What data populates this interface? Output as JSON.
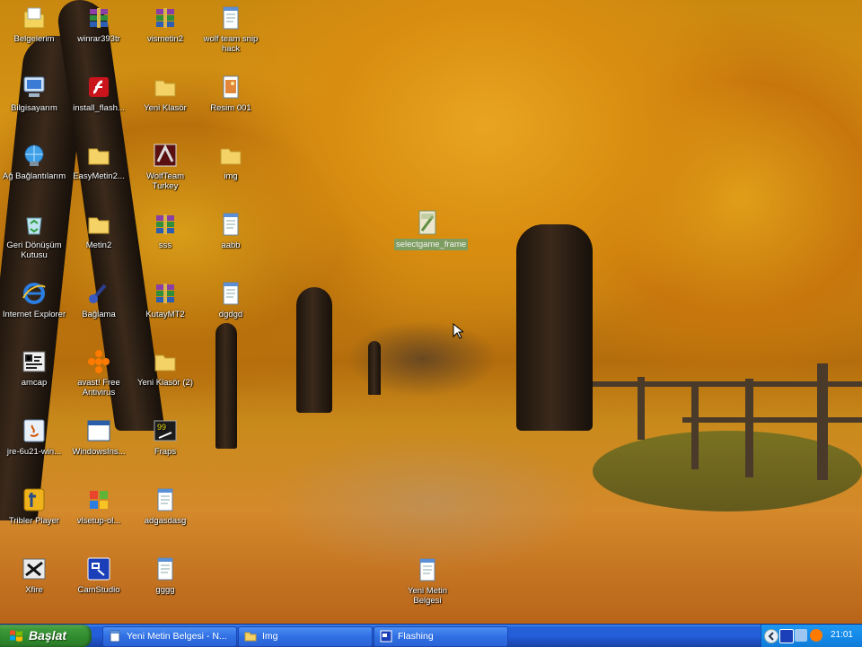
{
  "desktop": {
    "icons": [
      {
        "label": "Belgelerim",
        "icon": "my-documents-icon"
      },
      {
        "label": "Bilgisayarım",
        "icon": "my-computer-icon"
      },
      {
        "label": "Ağ Bağlantılarım",
        "icon": "network-connections-icon"
      },
      {
        "label": "Geri Dönüşüm Kutusu",
        "icon": "recycle-bin-icon"
      },
      {
        "label": "Internet Explorer",
        "icon": "internet-explorer-icon"
      },
      {
        "label": "amcap",
        "icon": "amcap-icon"
      },
      {
        "label": "jre-6u21-win...",
        "icon": "java-installer-icon"
      },
      {
        "label": "Tribler Player",
        "icon": "tribler-player-icon"
      },
      {
        "label": "Xfire",
        "icon": "xfire-icon"
      },
      {
        "label": "winrar393tr",
        "icon": "winrar-archive-icon"
      },
      {
        "label": "install_flash...",
        "icon": "flash-installer-icon"
      },
      {
        "label": "EasyMetin2...",
        "icon": "folder-icon"
      },
      {
        "label": "Metin2",
        "icon": "folder-icon"
      },
      {
        "label": "Bağlama",
        "icon": "program-icon"
      },
      {
        "label": "avast! Free Antivirus",
        "icon": "avast-icon"
      },
      {
        "label": "WindowsIns...",
        "icon": "window-icon"
      },
      {
        "label": "vlsetup-ol...",
        "icon": "windows-setup-icon"
      },
      {
        "label": "CamStudio",
        "icon": "camstudio-icon"
      },
      {
        "label": "vismetin2",
        "icon": "winrar-archive-icon"
      },
      {
        "label": "Yeni Klasör",
        "icon": "folder-icon"
      },
      {
        "label": "WolfTeam Turkey",
        "icon": "wolfteam-icon"
      },
      {
        "label": "sss",
        "icon": "winrar-archive-icon"
      },
      {
        "label": "KutayMT2",
        "icon": "winrar-archive-icon"
      },
      {
        "label": "Yeni Klasör (2)",
        "icon": "folder-icon"
      },
      {
        "label": "Fraps",
        "icon": "fraps-icon"
      },
      {
        "label": "adgasdasg",
        "icon": "notepad-document-icon"
      },
      {
        "label": "gggg",
        "icon": "notepad-document-icon"
      },
      {
        "label": "wolf team snip hack",
        "icon": "notepad-document-icon"
      },
      {
        "label": "Resim 001",
        "icon": "image-file-icon"
      },
      {
        "label": "img",
        "icon": "folder-icon"
      },
      {
        "label": "aabb",
        "icon": "notepad-document-icon"
      },
      {
        "label": "dgdgd",
        "icon": "notepad-document-icon"
      },
      {
        "label": "selectgame_frame",
        "icon": "image-file-icon",
        "selected": true
      },
      {
        "label": "Yeni Metin Belgesi",
        "icon": "notepad-document-icon"
      }
    ]
  },
  "taskbar": {
    "start_label": "Başlat",
    "tasks": [
      {
        "label": "Yeni Metin Belgesi - N...",
        "icon": "notepad-icon"
      },
      {
        "label": "Img",
        "icon": "folder-icon"
      },
      {
        "label": "Flashing",
        "icon": "camstudio-icon"
      }
    ],
    "clock": "21:01"
  },
  "colors": {
    "taskbar_blue": "#245edb",
    "start_green": "#3c9a3a",
    "tray_blue": "#148bea",
    "selection_green": "#6ea06e"
  }
}
